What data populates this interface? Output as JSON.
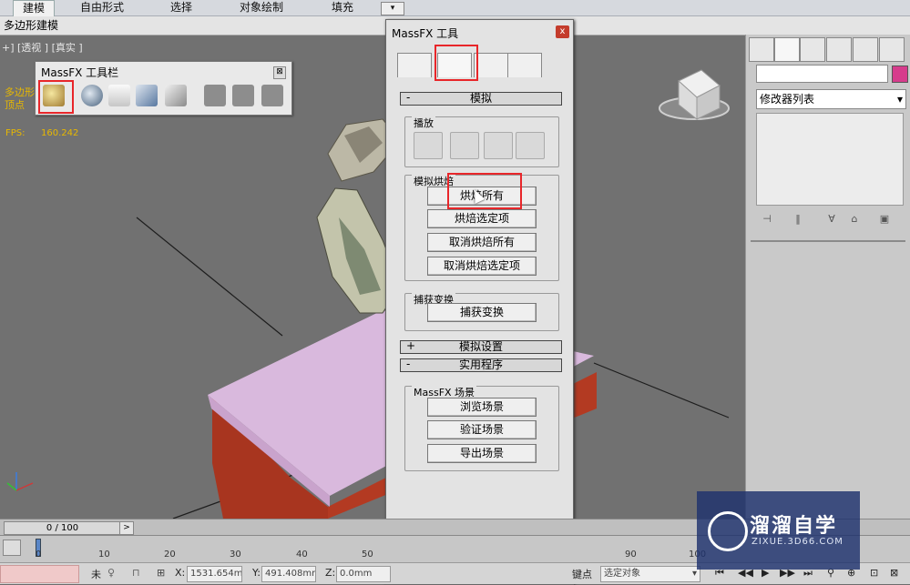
{
  "ribbon": {
    "tabs": [
      "建模",
      "自由形式",
      "选择",
      "对象绘制",
      "填充"
    ],
    "active_index": 0,
    "sub_label": "多边形建模"
  },
  "viewport": {
    "label": "+] [透视 ] [真实 ]",
    "poly_text": "多边形",
    "vertex_text": "顶点",
    "fps_label": "FPS:",
    "fps_value": "160.242"
  },
  "massfx_toolbar": {
    "title": "MassFX 工具栏",
    "close": "⊠"
  },
  "massfx_dialog": {
    "title": "MassFX 工具",
    "close": "x",
    "sim_rollout": {
      "sign": "-",
      "title": "模拟"
    },
    "playback_label": "播放",
    "bake_label": "模拟烘焙",
    "bake_buttons": [
      "烘焙所有",
      "烘焙选定项",
      "取消烘焙所有",
      "取消烘焙选定项"
    ],
    "capture_label": "捕获变换",
    "capture_button": "捕获变换",
    "settings_rollout": {
      "sign": "+",
      "title": "模拟设置"
    },
    "utility_rollout": {
      "sign": "-",
      "title": "实用程序"
    },
    "scene_label": "MassFX 场景",
    "scene_buttons": [
      "浏览场景",
      "验证场景",
      "导出场景"
    ]
  },
  "command_panel": {
    "modifier_list": "修改器列表",
    "swatch_color": "#d63c8c"
  },
  "timeline": {
    "frame": "0 / 100",
    "ticks": [
      "0",
      "10",
      "20",
      "30",
      "40",
      "50",
      "90",
      "100"
    ]
  },
  "status": {
    "x_label": "X:",
    "x_value": "1531.654m",
    "y_label": "Y:",
    "y_value": "491.408mm",
    "z_label": "Z:",
    "z_value": "0.0mm",
    "key_label": "键点",
    "selection_mode": "选定对象",
    "left_char": "未"
  },
  "watermark": {
    "brand": "溜溜自学",
    "site": "ZIXUE.3D66.COM"
  }
}
